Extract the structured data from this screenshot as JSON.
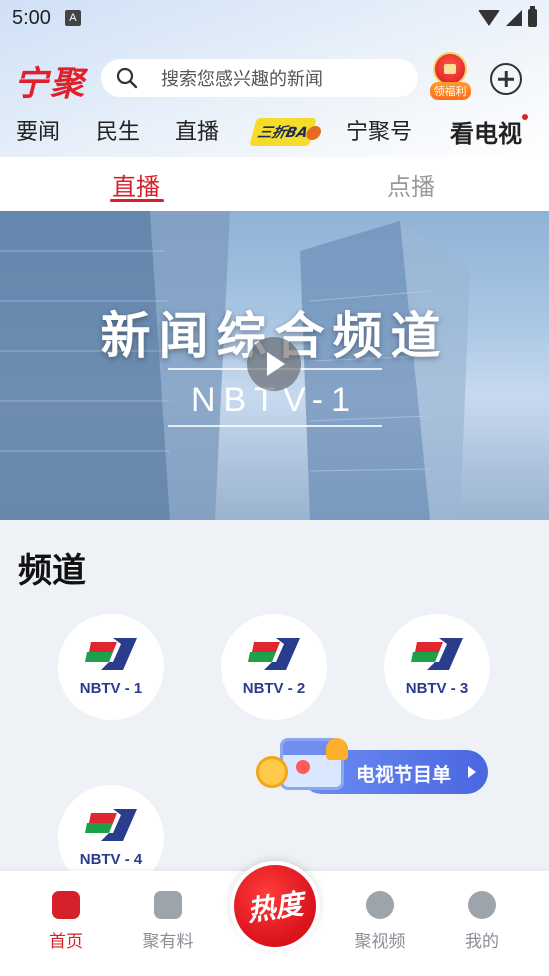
{
  "status_bar": {
    "time": "5:00",
    "a_indicator": "A"
  },
  "header": {
    "logo": "宁聚",
    "search": {
      "placeholder": "搜索您感兴趣的新闻"
    },
    "reward_label": "领福利",
    "add_icon": "plus-circle-icon"
  },
  "nav_tabs": [
    {
      "label": "要闻"
    },
    {
      "label": "民生"
    },
    {
      "label": "直播"
    },
    {
      "label": "三折BA"
    },
    {
      "label": "宁聚号"
    },
    {
      "label": "看电视",
      "active": true
    }
  ],
  "sub_tabs": [
    {
      "label": "直播",
      "active": true
    },
    {
      "label": "点播",
      "active": false
    }
  ],
  "banner": {
    "title": "新闻综合频道",
    "subtitle": "NBTV-1"
  },
  "channels_section": {
    "title": "频道",
    "channels": [
      {
        "label": "NBTV - 1"
      },
      {
        "label": "NBTV - 2"
      },
      {
        "label": "NBTV - 3"
      },
      {
        "label": "NBTV - 4"
      }
    ],
    "tv_guide_label": "电视节目单"
  },
  "bottom_nav": [
    {
      "label": "首页",
      "icon": "home-icon",
      "active": true
    },
    {
      "label": "聚有料",
      "icon": "bolt-box-icon",
      "active": false
    },
    {
      "label": "热度",
      "icon": "hot-icon",
      "active": false
    },
    {
      "label": "聚视频",
      "icon": "video-bubble-icon",
      "active": false
    },
    {
      "label": "我的",
      "icon": "profile-icon",
      "active": false
    }
  ],
  "colors": {
    "accent_red": "#d6202a",
    "guide_blue": "#4a66e0",
    "channel_text": "#2a3c8c"
  }
}
